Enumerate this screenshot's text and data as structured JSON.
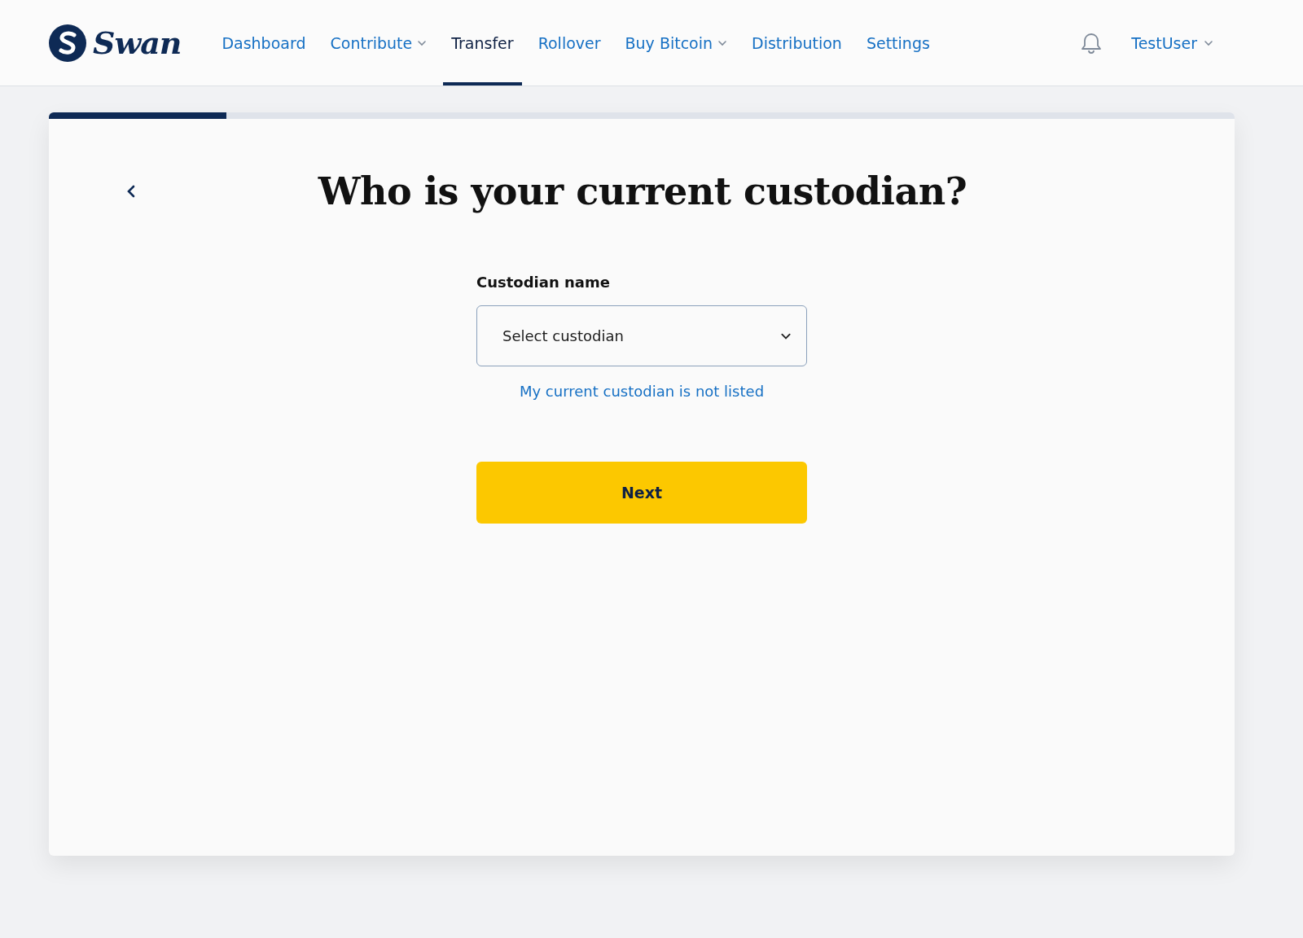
{
  "header": {
    "logo": "Swan",
    "nav": [
      {
        "label": "Dashboard",
        "selected": false,
        "has_menu": false
      },
      {
        "label": "Contribute",
        "selected": false,
        "has_menu": true
      },
      {
        "label": "Transfer",
        "selected": true,
        "has_menu": false
      },
      {
        "label": "Rollover",
        "selected": false,
        "has_menu": false
      },
      {
        "label": "Buy Bitcoin",
        "selected": false,
        "has_menu": true
      },
      {
        "label": "Distribution",
        "selected": false,
        "has_menu": false
      },
      {
        "label": "Settings",
        "selected": false,
        "has_menu": false
      }
    ],
    "user": "TestUser"
  },
  "card": {
    "progress": {
      "level": 0.15
    },
    "title": "Who is your current custodian?",
    "field": {
      "label": "Custodian name",
      "placeholder": "Select custodian"
    },
    "link": "My current custodian is not listed",
    "button": "Next"
  }
}
